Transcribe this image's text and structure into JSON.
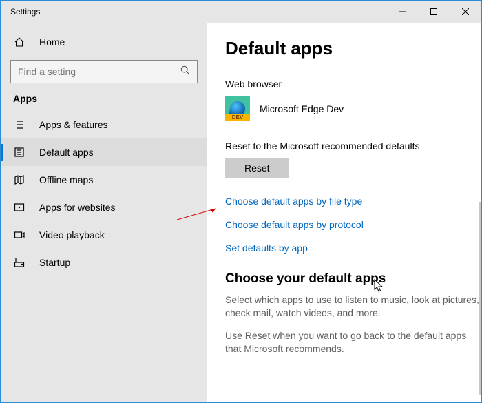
{
  "window": {
    "title": "Settings"
  },
  "sidebar": {
    "home": "Home",
    "search_placeholder": "Find a setting",
    "section": "Apps",
    "items": [
      {
        "label": "Apps & features"
      },
      {
        "label": "Default apps"
      },
      {
        "label": "Offline maps"
      },
      {
        "label": "Apps for websites"
      },
      {
        "label": "Video playback"
      },
      {
        "label": "Startup"
      }
    ]
  },
  "main": {
    "heading": "Default apps",
    "browser_label": "Web browser",
    "browser_name": "Microsoft Edge Dev",
    "browser_badge": "DEV",
    "reset_label": "Reset to the Microsoft recommended defaults",
    "reset_button": "Reset",
    "link_filetype": "Choose default apps by file type",
    "link_protocol": "Choose default apps by protocol",
    "link_byapp": "Set defaults by app",
    "choose_heading": "Choose your default apps",
    "choose_desc1": "Select which apps to use to listen to music, look at pictures, check mail, watch videos, and more.",
    "choose_desc2": "Use Reset when you want to go back to the default apps that Microsoft recommends."
  }
}
